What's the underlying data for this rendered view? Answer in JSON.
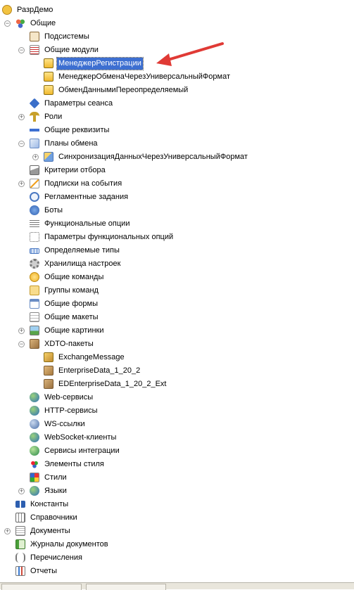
{
  "tree": {
    "root_label": "РазрДемо",
    "common_label": "Общие",
    "subsystems": "Подсистемы",
    "common_modules": "Общие модули",
    "modules": [
      "МенеджерРегистрации",
      "МенеджерОбменаЧерезУниверсальныйФормат",
      "ОбменДаннымиПереопределяемый"
    ],
    "session_params": "Параметры сеанса",
    "roles": "Роли",
    "common_attrs": "Общие реквизиты",
    "exchange_plans": "Планы обмена",
    "exchange_plan_item": "СинхронизацияДанныхЧерезУниверсальныйФормат",
    "filter_criteria": "Критерии отбора",
    "event_subscriptions": "Подписки на события",
    "scheduled_jobs": "Регламентные задания",
    "bots": "Боты",
    "functional_options": "Функциональные опции",
    "functional_option_params": "Параметры функциональных опций",
    "defined_types": "Определяемые типы",
    "settings_storages": "Хранилища настроек",
    "common_commands": "Общие команды",
    "command_groups": "Группы команд",
    "common_forms": "Общие формы",
    "common_templates": "Общие макеты",
    "common_pictures": "Общие картинки",
    "xdto_packages": "XDTO-пакеты",
    "xdto_items": [
      "ExchangeMessage",
      "EnterpriseData_1_20_2",
      "EDEnterpriseData_1_20_2_Ext"
    ],
    "web_services": "Web-сервисы",
    "http_services": "HTTP-сервисы",
    "ws_links": "WS-ссылки",
    "websocket_clients": "WebSocket-клиенты",
    "integration_services": "Сервисы интеграции",
    "style_elements": "Элементы стиля",
    "styles": "Стили",
    "languages": "Языки",
    "constants": "Константы",
    "catalogs": "Справочники",
    "documents": "Документы",
    "document_journals": "Журналы документов",
    "enums": "Перечисления",
    "reports": "Отчеты"
  },
  "colors": {
    "selection": "#3d6fd1",
    "arrow": "#e03a35"
  }
}
